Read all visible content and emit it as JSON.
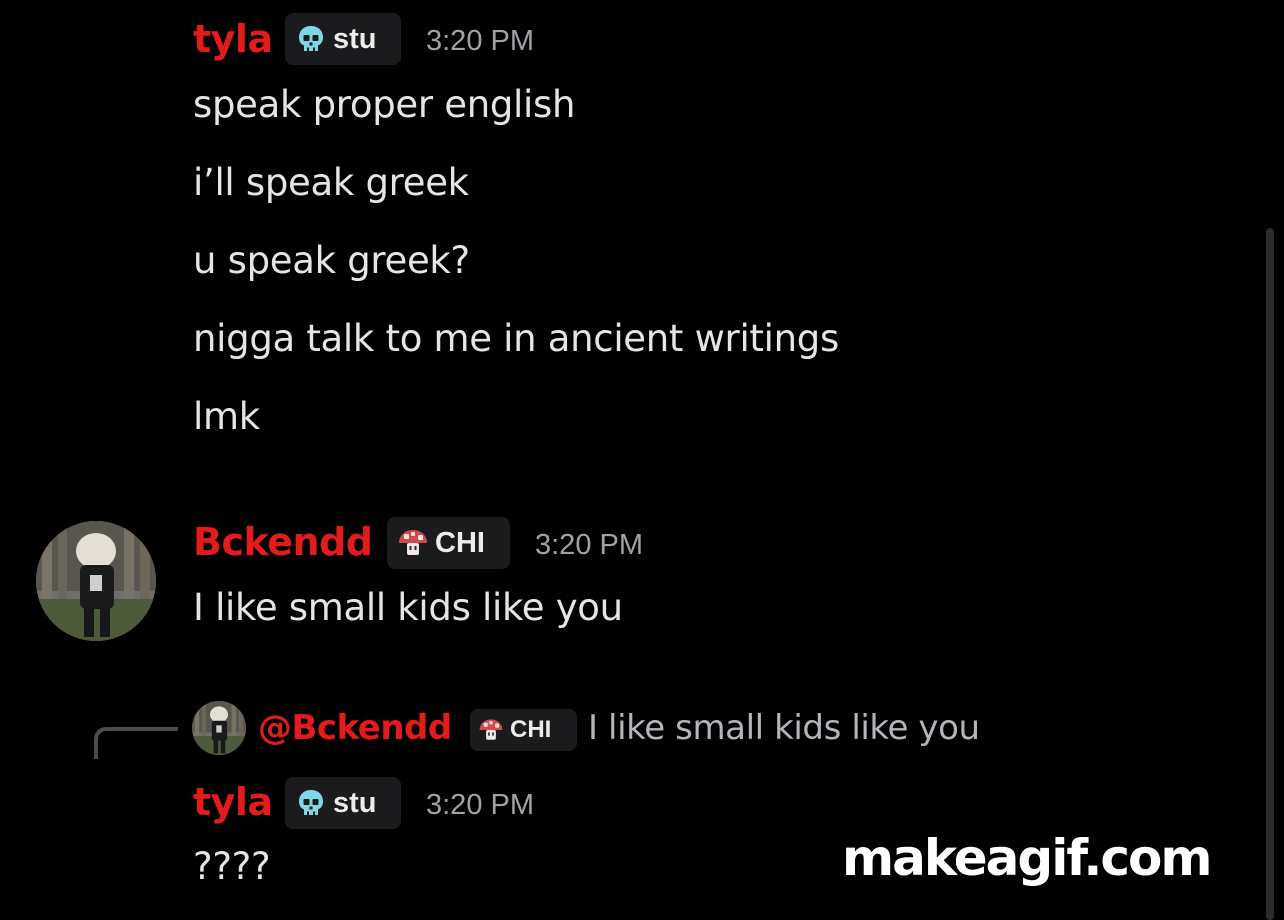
{
  "colors": {
    "background": "#000000",
    "username": "#e31b1b",
    "mention": "#e31b1b",
    "message_text": "#e4e5e8",
    "timestamp": "#a1a2a7",
    "tag_background": "#1b1b1e",
    "skull_icon": "#7fd7e4",
    "mushroom_icon": "#d14a4a"
  },
  "messages": [
    {
      "author": "tyla",
      "role_icon": "skull-icon",
      "role_tag": "stu",
      "timestamp": "3:20 PM",
      "lines": [
        "speak proper english",
        "i’ll speak greek",
        "u speak greek?",
        "nigga talk to me in ancient writings",
        "lmk"
      ]
    },
    {
      "author": "Bckendd",
      "role_icon": "mushroom-icon",
      "role_tag": "CHI",
      "timestamp": "3:20 PM",
      "lines": [
        "I like small kids like you"
      ]
    },
    {
      "author": "tyla",
      "role_icon": "skull-icon",
      "role_tag": "stu",
      "timestamp": "3:20 PM",
      "reply": {
        "mention": "@Bckendd",
        "role_tag": "CHI",
        "preview": "I like small kids like you"
      },
      "lines": [
        "????"
      ]
    }
  ],
  "watermark": "makeagif.com"
}
